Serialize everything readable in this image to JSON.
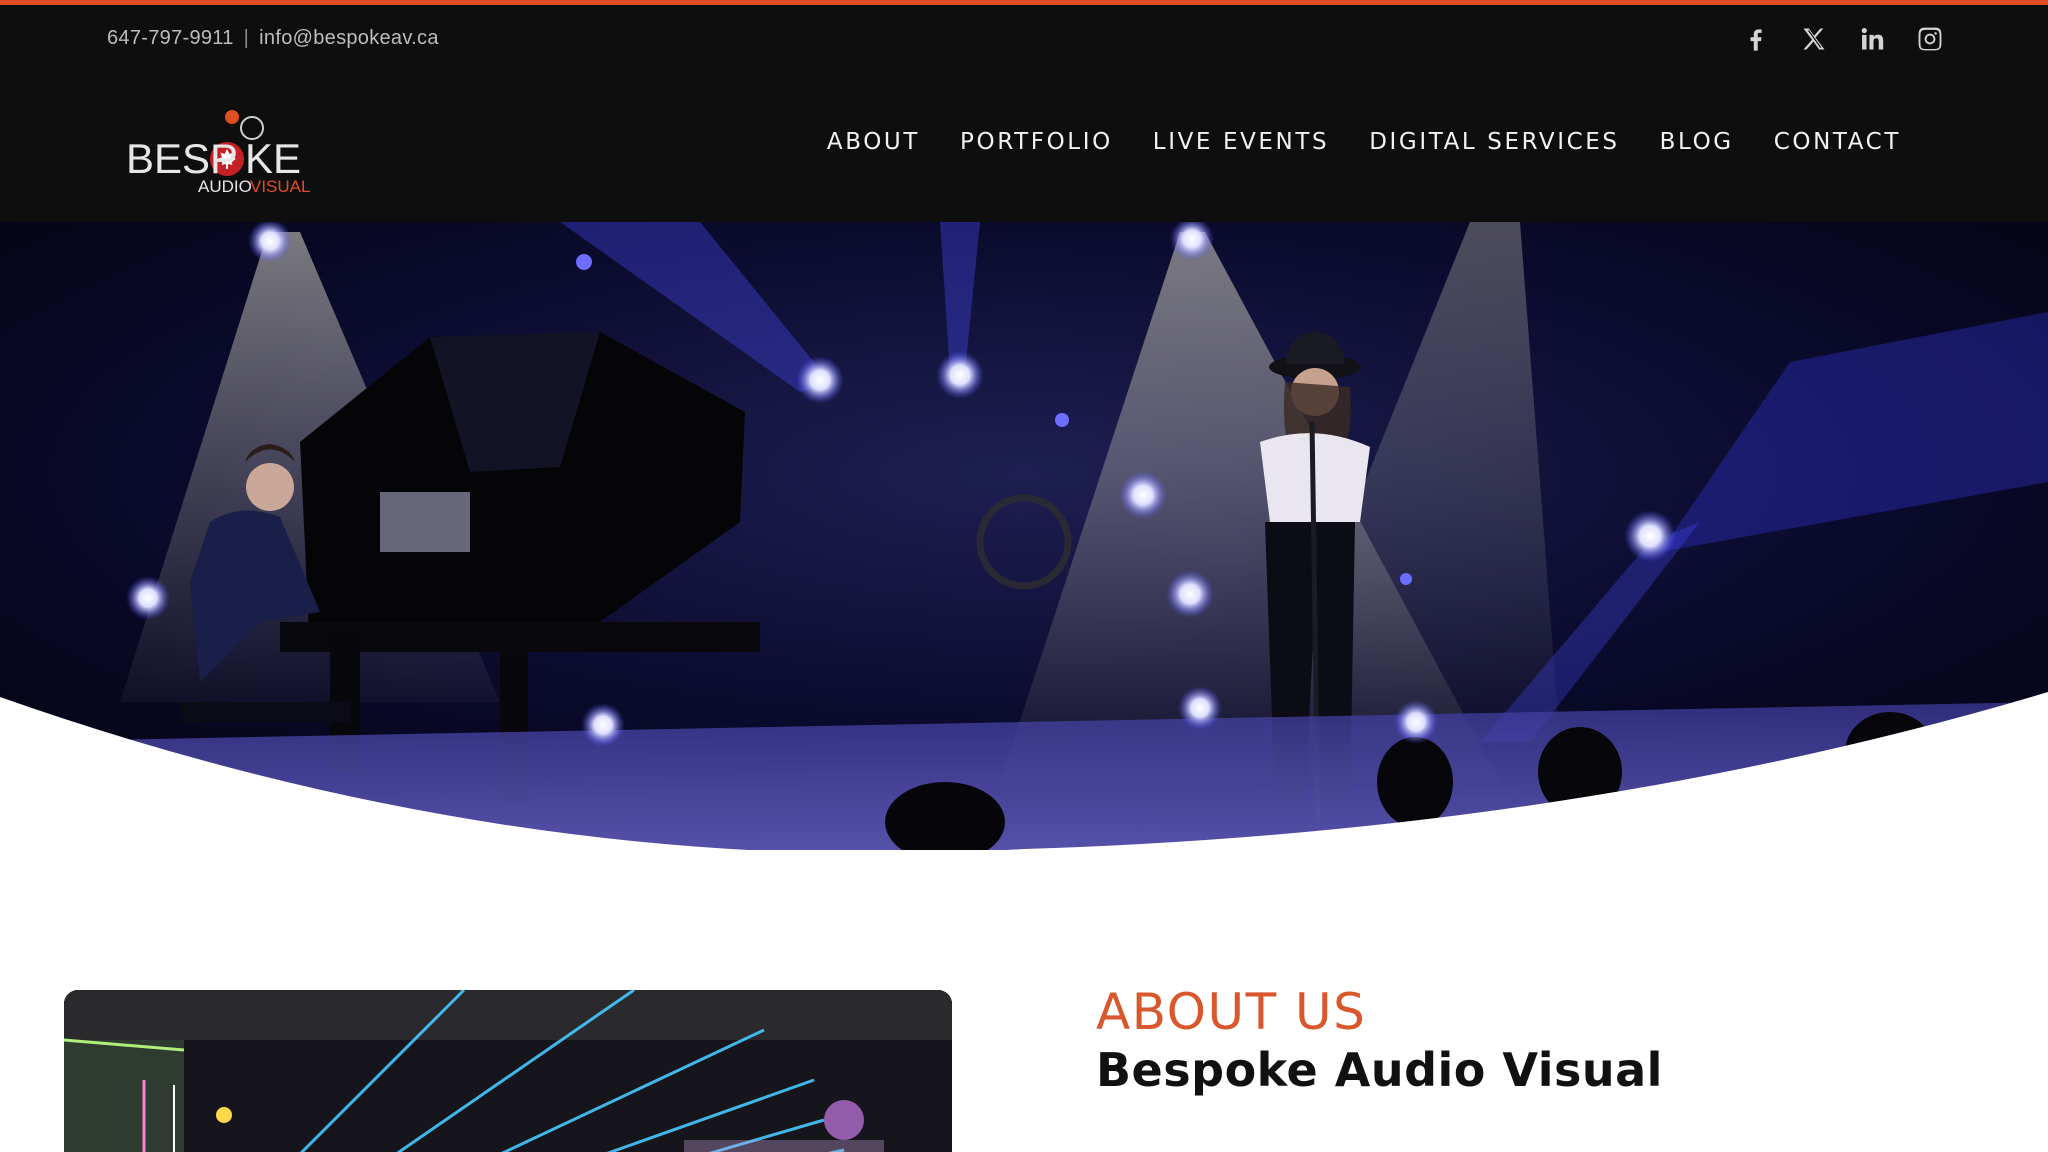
{
  "topbar": {
    "phone": "647-797-9911",
    "separator": "|",
    "email": "info@bespokeav.ca",
    "social": [
      {
        "name": "facebook-icon"
      },
      {
        "name": "x-twitter-icon"
      },
      {
        "name": "linkedin-icon"
      },
      {
        "name": "instagram-icon"
      }
    ]
  },
  "brand": {
    "name": "BESPOKE",
    "sub_left": "AUDIO",
    "sub_right": "VISUAL",
    "accent_color": "#e04e26"
  },
  "nav": {
    "items": [
      "ABOUT",
      "PORTFOLIO",
      "LIVE EVENTS",
      "DIGITAL SERVICES",
      "BLOG",
      "CONTACT"
    ]
  },
  "about": {
    "eyebrow": "ABOUT US",
    "title": "Bespoke Audio Visual"
  }
}
